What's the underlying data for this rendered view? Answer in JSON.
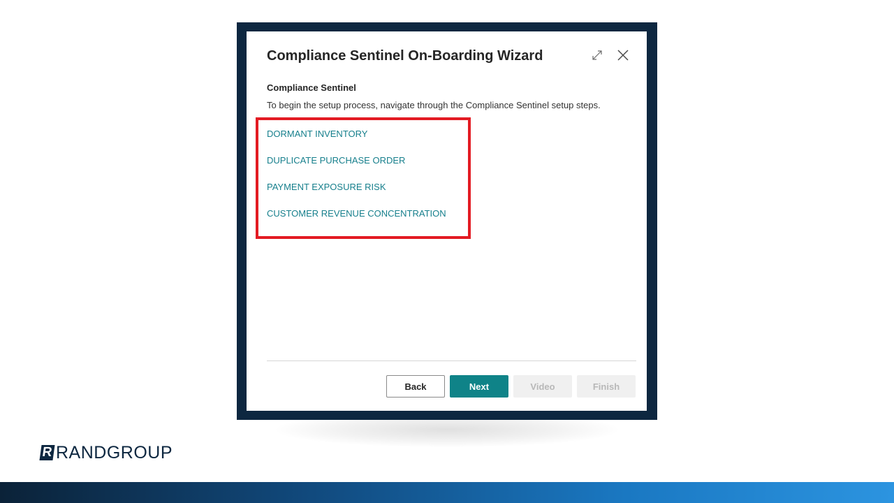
{
  "dialog": {
    "title": "Compliance Sentinel On-Boarding Wizard",
    "section_title": "Compliance Sentinel",
    "description": "To begin the setup process, navigate through the Compliance Sentinel setup steps.",
    "steps": [
      {
        "label": "DORMANT INVENTORY"
      },
      {
        "label": "DUPLICATE PURCHASE ORDER"
      },
      {
        "label": "PAYMENT EXPOSURE RISK"
      },
      {
        "label": "CUSTOMER REVENUE CONCENTRATION"
      }
    ],
    "buttons": {
      "back": "Back",
      "next": "Next",
      "video": "Video",
      "finish": "Finish"
    },
    "icons": {
      "expand": "expand-icon",
      "close": "close-icon"
    }
  },
  "brand": {
    "mark": "R",
    "rand": "RAND",
    "group": "GROUP"
  },
  "colors": {
    "frame": "#0d2740",
    "link": "#167f8c",
    "primary_button": "#0f8388",
    "highlight": "#e31b23"
  }
}
